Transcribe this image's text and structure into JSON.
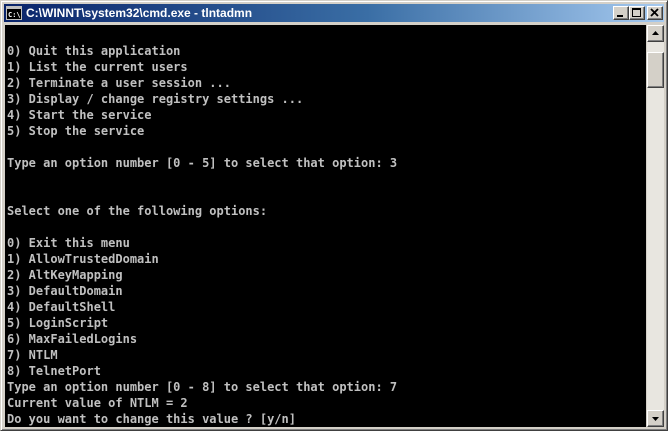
{
  "window": {
    "title": "C:\\WINNT\\system32\\cmd.exe - tlntadmn",
    "icon": "cmd-icon"
  },
  "titlebar_buttons": {
    "minimize": "minimize-icon",
    "maximize": "maximize-icon",
    "close": "close-icon"
  },
  "console": {
    "lines": [
      "",
      "0) Quit this application",
      "1) List the current users",
      "2) Terminate a user session ...",
      "3) Display / change registry settings ...",
      "4) Start the service",
      "5) Stop the service",
      "",
      "Type an option number [0 - 5] to select that option: 3",
      "",
      "",
      "Select one of the following options:",
      "",
      "0) Exit this menu",
      "1) AllowTrustedDomain",
      "2) AltKeyMapping",
      "3) DefaultDomain",
      "4) DefaultShell",
      "5) LoginScript",
      "6) MaxFailedLogins",
      "7) NTLM",
      "8) TelnetPort",
      "Type an option number [0 - 8] to select that option: 7",
      "Current value of NTLM = 2",
      "Do you want to change this value ? [y/n]"
    ]
  },
  "scrollbar": {
    "up": "scroll-up-arrow-icon",
    "down": "scroll-down-arrow-icon"
  },
  "colors": {
    "titlebar_start": "#0a246a",
    "titlebar_end": "#a6caf0",
    "console_bg": "#000000",
    "console_text": "#c0c0c0",
    "chrome": "#d4d0c8"
  }
}
